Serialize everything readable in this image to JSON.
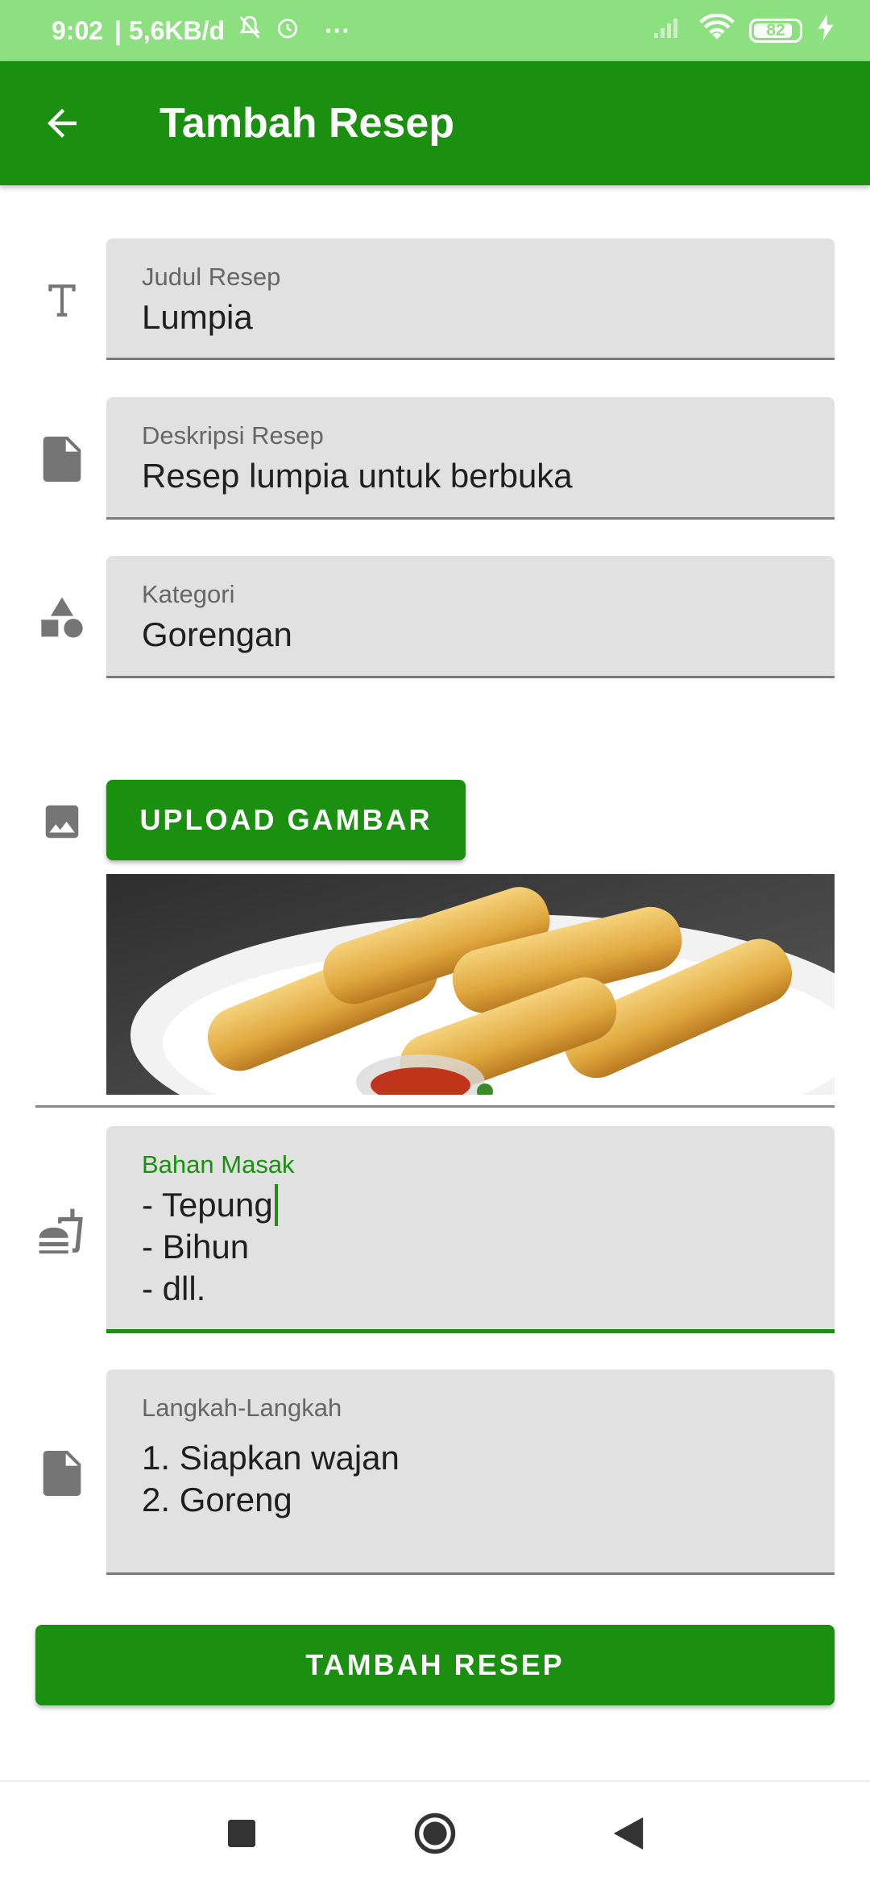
{
  "status_bar": {
    "time": "9:02",
    "network_speed": "| 5,6KB/d",
    "more": "···",
    "battery": "82"
  },
  "app_bar": {
    "title": "Tambah Resep"
  },
  "form": {
    "title_field": {
      "label": "Judul Resep",
      "value": "Lumpia"
    },
    "description_field": {
      "label": "Deskripsi Resep",
      "value": "Resep lumpia untuk berbuka"
    },
    "category_field": {
      "label": "Kategori",
      "value": "Gorengan"
    },
    "upload_button": "UPLOAD GAMBAR",
    "ingredients_field": {
      "label": "Bahan Masak",
      "lines": [
        "- Tepung",
        "- Bihun",
        "- dll."
      ]
    },
    "steps_field": {
      "label": "Langkah-Langkah",
      "lines": [
        "1. Siapkan wajan",
        "2. Goreng"
      ]
    },
    "submit_button": "TAMBAH RESEP"
  },
  "colors": {
    "primary": "#1b8f10",
    "status_bar": "#8ce080",
    "field_bg": "#e1e1e1"
  },
  "icons": {
    "title": "text-format-icon",
    "description": "document-icon",
    "category": "shapes-icon",
    "image": "image-icon",
    "ingredients": "fastfood-icon",
    "steps": "document-icon"
  }
}
